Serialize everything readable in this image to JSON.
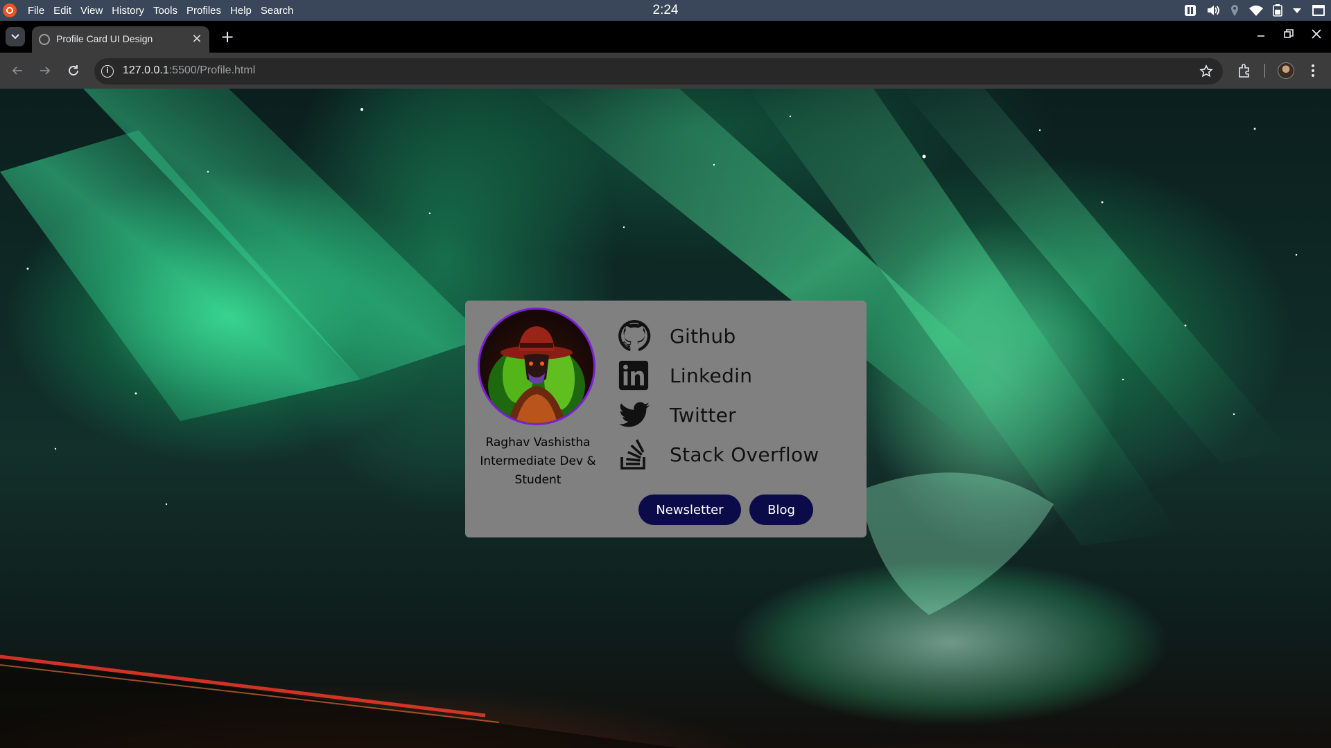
{
  "os": {
    "menu": [
      "File",
      "Edit",
      "View",
      "History",
      "Tools",
      "Profiles",
      "Help",
      "Search"
    ],
    "clock": "2:24"
  },
  "browser": {
    "tab_title": "Profile Card UI Design",
    "url_host": "127.0.0.1",
    "url_path": ":5500/Profile.html"
  },
  "profile": {
    "name": "Raghav Vashistha",
    "role_line1": "Intermediate Dev &",
    "role_line2": "Student",
    "links": [
      {
        "label": "Github",
        "icon": "github-icon"
      },
      {
        "label": "Linkedin",
        "icon": "linkedin-icon"
      },
      {
        "label": "Twitter",
        "icon": "twitter-icon"
      },
      {
        "label": "Stack Overflow",
        "icon": "stackoverflow-icon"
      }
    ],
    "buttons": {
      "newsletter": "Newsletter",
      "blog": "Blog"
    }
  },
  "colors": {
    "card_bg": "#808080",
    "button_bg": "#0b0b4a",
    "avatar_border": "#7c1fd6"
  }
}
